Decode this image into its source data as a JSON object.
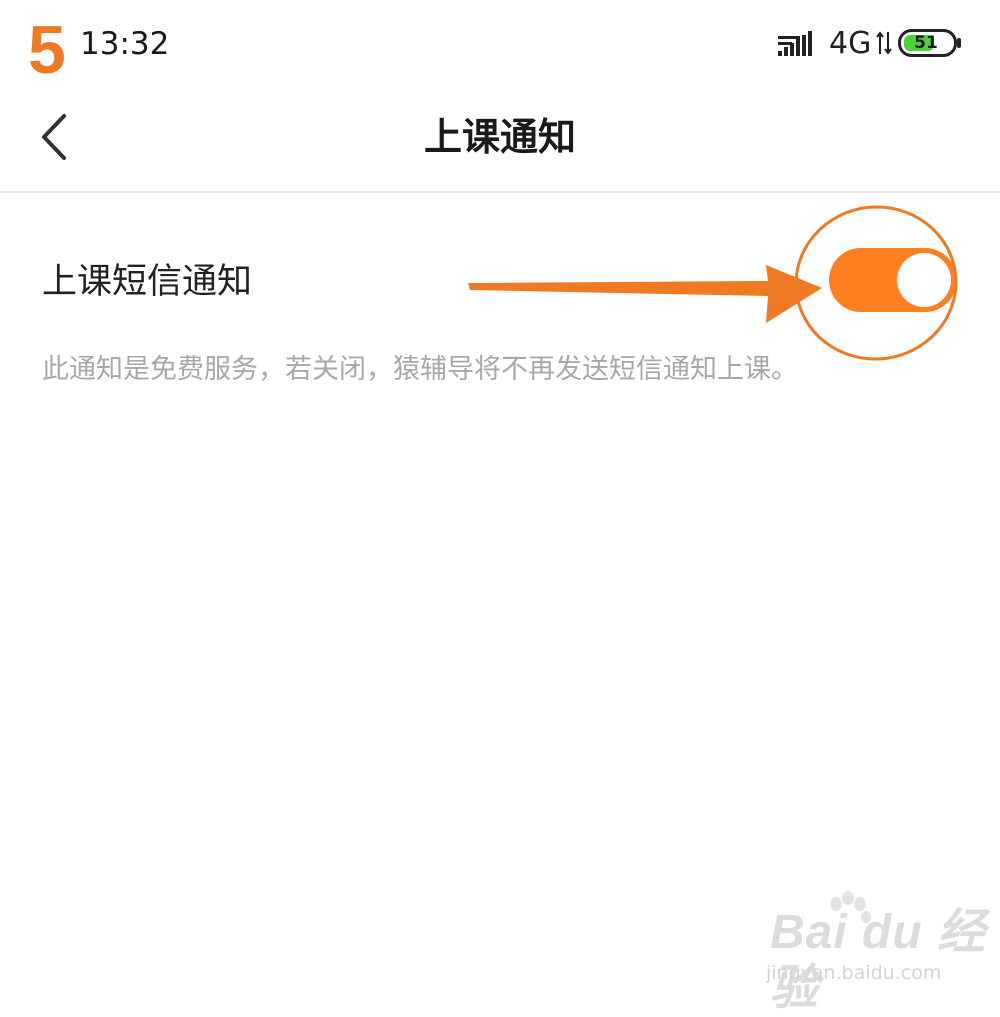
{
  "step_badge": "5",
  "status_bar": {
    "time": "13:32",
    "network": "4G",
    "battery": "51",
    "signal_icon": "signal-bars-icon",
    "data_icon": "data-arrows-icon",
    "battery_icon": "battery-icon"
  },
  "nav": {
    "back_icon": "chevron-left-icon",
    "title": "上课通知"
  },
  "setting": {
    "label": "上课短信通知",
    "enabled": true,
    "description": "此通知是免费服务，若关闭，猿辅导将不再发送短信通知上课。"
  },
  "colors": {
    "accent": "#ff7f1f",
    "annotation": "#f07a24",
    "description_text": "#a8a8a8"
  },
  "watermark": {
    "logo": "Bai du 经验",
    "url": "jingyan.baidu.com"
  }
}
